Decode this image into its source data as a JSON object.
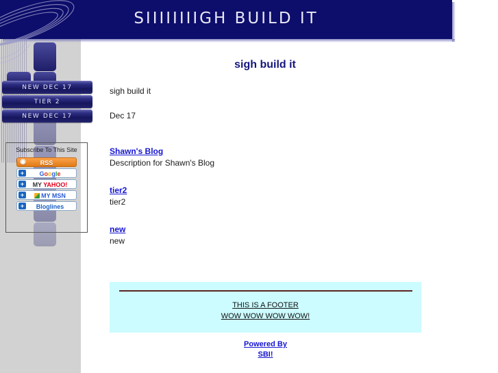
{
  "header": {
    "title_main": "SIIIIIIIIGH BUILD IT",
    "bg_color": "#0d0d6b",
    "text_color": "#e9e9f6"
  },
  "sidebar": {
    "nav_items": [
      {
        "label": "NEW DEC 17"
      },
      {
        "label": "TIER 2"
      },
      {
        "label": "NEW DEC 17"
      }
    ],
    "subscribe": {
      "title": "Subscribe To This Site",
      "buttons": [
        {
          "name": "rss",
          "label": "RSS",
          "icon": "rss-icon",
          "plus": ""
        },
        {
          "name": "google",
          "label": "Google",
          "icon": "plus-icon",
          "plus": "+"
        },
        {
          "name": "my-yahoo",
          "label": "MY YAHOO!",
          "icon": "plus-icon",
          "plus": "+"
        },
        {
          "name": "my-msn",
          "label": "MY MSN",
          "icon": "plus-icon",
          "plus": "+"
        },
        {
          "name": "bloglines",
          "label": "Bloglines",
          "icon": "plus-icon",
          "plus": "+"
        }
      ]
    }
  },
  "main": {
    "page_title": "sigh build it",
    "intro_line": "sigh build it",
    "date_line": "Dec 17",
    "entries": [
      {
        "link": "Shawn's Blog",
        "desc": "Description for Shawn's Blog"
      },
      {
        "link": "tier2",
        "desc": "tier2"
      },
      {
        "link": "new",
        "desc": "new"
      }
    ]
  },
  "footer": {
    "bg_color": "#ccfcff",
    "links": [
      {
        "label": "THIS IS A FOOTER"
      },
      {
        "label": "WOW WOW WOW WOW!"
      }
    ],
    "powered": [
      {
        "label": "Powered By"
      },
      {
        "label": "SBI!"
      }
    ]
  }
}
